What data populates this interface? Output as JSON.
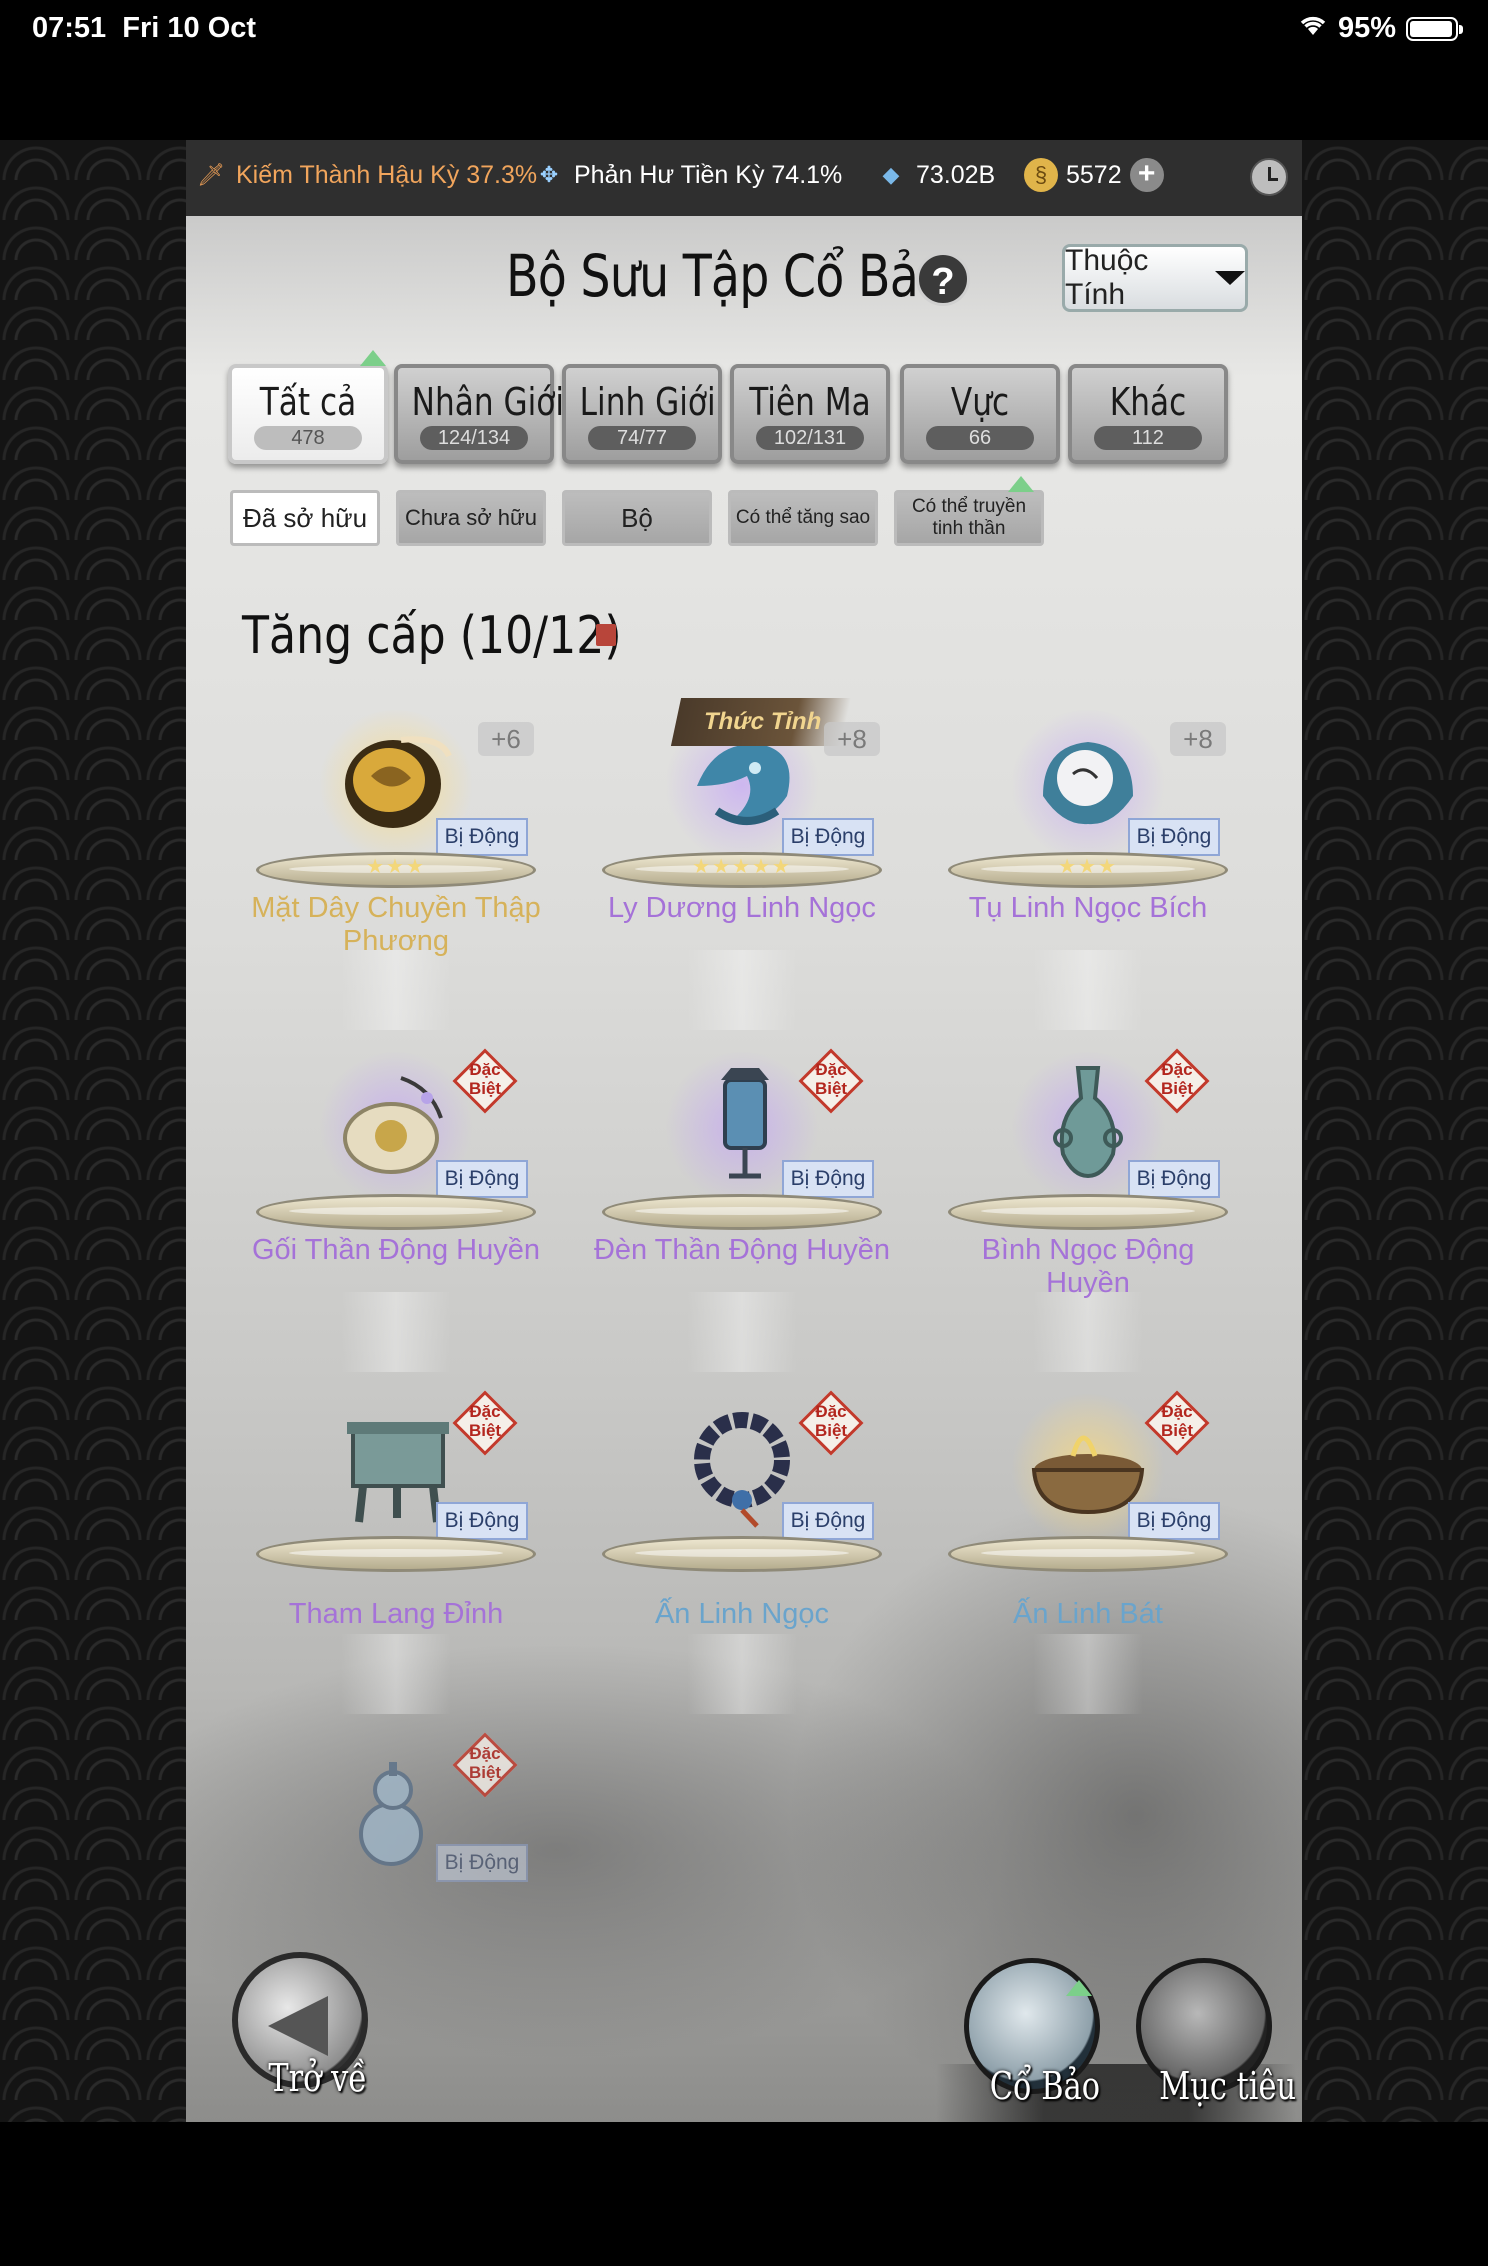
{
  "status_bar": {
    "time": "07:51",
    "date": "Fri 10 Oct",
    "battery": "95%",
    "battery_level": 0.95,
    "wifi_icon": "wifi-icon"
  },
  "resources": {
    "realm_1": "Kiếm Thành Hậu Kỳ 37.3%",
    "realm_2": "Phản Hư Tiền Kỳ 74.1%",
    "spirit_stone": "73.02B",
    "currency": "5572"
  },
  "header": {
    "title": "Bộ Sưu Tập Cổ Bảo",
    "help": "?",
    "attribute_button": "Thuộc Tính"
  },
  "tabs": [
    {
      "label": "Tất cả",
      "count": "478"
    },
    {
      "label": "Nhân Giới",
      "count": "124/134"
    },
    {
      "label": "Linh Giới",
      "count": "74/77"
    },
    {
      "label": "Tiên Ma",
      "count": "102/131"
    },
    {
      "label": "Vực",
      "count": "66"
    },
    {
      "label": "Khác",
      "count": "112"
    }
  ],
  "filters": [
    {
      "label": "Đã sở hữu"
    },
    {
      "label": "Chưa sở hữu"
    },
    {
      "label": "Bộ"
    },
    {
      "label": "Có thể tăng sao"
    },
    {
      "label": "Có thể truyền tinh thần"
    }
  ],
  "section_title": "Tăng cấp (10/12)",
  "passive_label": "Bị Động",
  "special_label_1": "Đặc",
  "special_label_2": "Biệt",
  "awaken_label": "Thức Tỉnh",
  "items": [
    {
      "name": "Mặt Dây Chuyền Thập Phương",
      "level": "+6",
      "stars": 3,
      "star_glyphs": "★★★"
    },
    {
      "name": "Ly Dương Linh Ngọc",
      "level": "+8",
      "stars": 5,
      "star_glyphs": "★★★★★"
    },
    {
      "name": "Tụ Linh Ngọc Bích",
      "level": "+8",
      "stars": 3,
      "star_glyphs": "★★★"
    },
    {
      "name": "Gối Thần Động Huyền"
    },
    {
      "name": "Đèn Thần Động Huyền"
    },
    {
      "name": "Bình Ngọc Động Huyền"
    },
    {
      "name": "Tham Lang Đỉnh"
    },
    {
      "name": "Ấn Linh Ngọc"
    },
    {
      "name": "Ấn Linh Bát"
    },
    {
      "name": ""
    }
  ],
  "bottom": {
    "back": "Trở về",
    "relic": "Cổ Bảo",
    "goal": "Mục tiêu"
  }
}
